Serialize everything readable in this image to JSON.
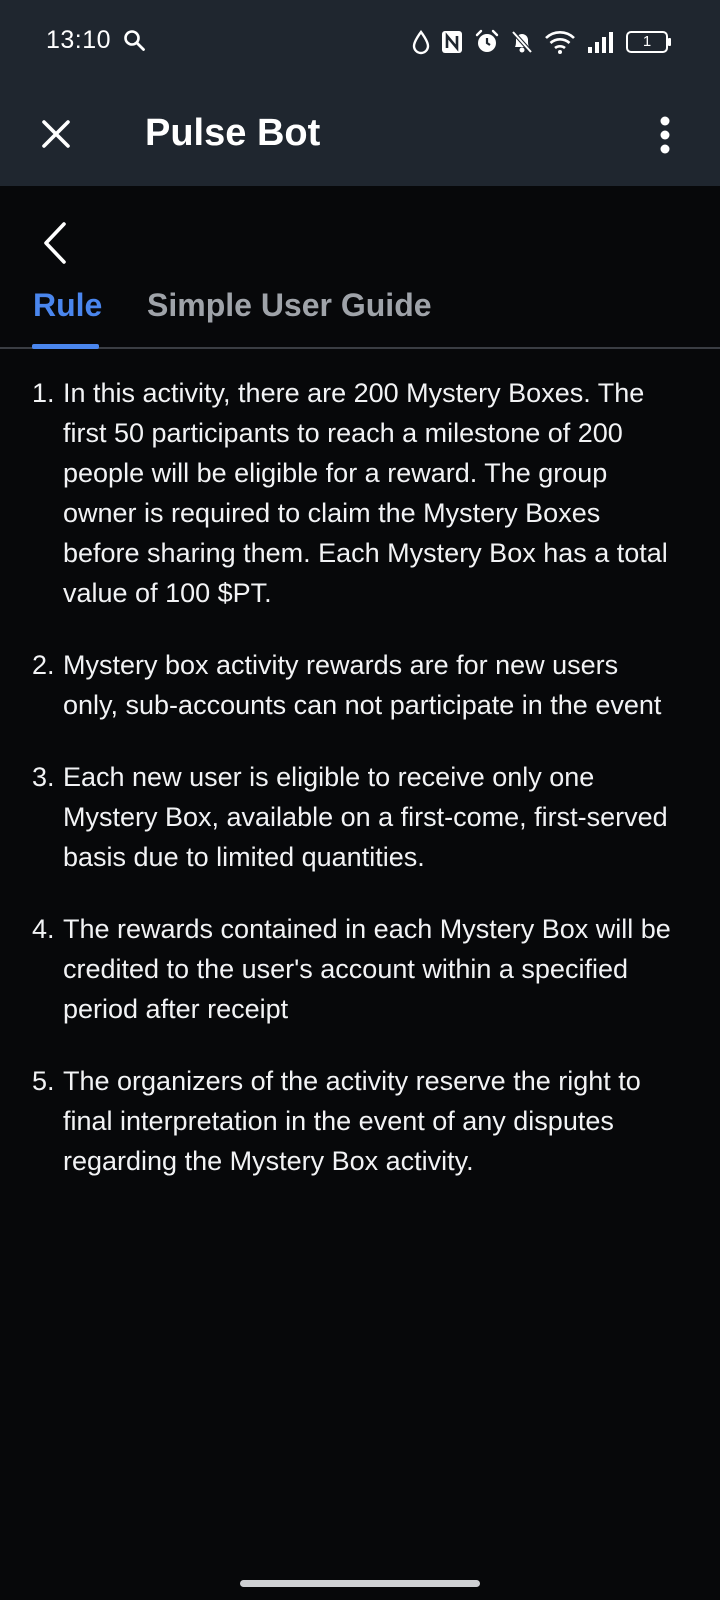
{
  "status_bar": {
    "time": "13:10",
    "battery_level": "1",
    "icons": [
      "search-icon",
      "water-drop-icon",
      "nfc-icon",
      "alarm-icon",
      "bell-off-icon",
      "wifi-icon",
      "signal-icon",
      "battery-icon"
    ]
  },
  "app_bar": {
    "title": "Pulse Bot"
  },
  "tabs": [
    {
      "label": "Rule",
      "active": true
    },
    {
      "label": "Simple User Guide",
      "active": false
    }
  ],
  "rules": [
    {
      "number": "1.",
      "text": "In this activity, there are 200 Mystery Boxes. The first 50 participants to reach a milestone of 200 people will be eligible for a reward. The group owner is required to claim the Mystery Boxes before sharing them. Each Mystery Box has a total value of 100 $PT."
    },
    {
      "number": "2.",
      "text": "Mystery box activity rewards are for new users only, sub-accounts can not participate in the event"
    },
    {
      "number": "3.",
      "text": "Each new user is eligible to receive only one Mystery Box, available on a first-come, first-served basis due to limited quantities."
    },
    {
      "number": "4.",
      "text": "The rewards contained in each Mystery Box will be credited to the user's account within a specified period after receipt"
    },
    {
      "number": "5.",
      "text": "The organizers of the activity reserve the right to final interpretation in the event of any disputes regarding the Mystery Box activity."
    }
  ],
  "colors": {
    "header_bg": "#1f262f",
    "page_bg": "#07080a",
    "accent": "#4a86ee",
    "inactive_tab": "#9fa3a9"
  }
}
